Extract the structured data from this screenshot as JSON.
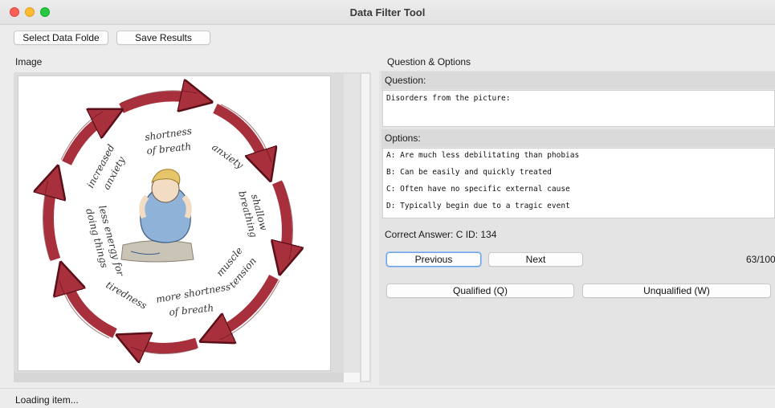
{
  "window": {
    "title": "Data Filter Tool"
  },
  "toolbar": {
    "select_folder_label": "Select Data Folde",
    "save_results_label": "Save Results"
  },
  "image_panel": {
    "label": "Image",
    "diagram": {
      "labels": {
        "shortness_of_breath_1": "shortness",
        "shortness_of_breath_2": "of breath",
        "anxiety": "anxiety",
        "shallow_1": "shallow",
        "shallow_2": "breathing",
        "muscle_1": "muscle",
        "muscle_2": "tension",
        "more_1": "more shortness",
        "more_2": "of breath",
        "tiredness": "tiredness",
        "less_energy_1": "less energy for",
        "less_energy_2": "doing things",
        "increased_1": "increased",
        "increased_2": "anxiety"
      },
      "arrow_color": "#a8303c"
    }
  },
  "right_panel": {
    "label": "Question & Options",
    "question_header": "Question:",
    "question_text": "Disorders from the picture:",
    "options_header": "Options:",
    "options": [
      "A: Are much less debilitating than phobias",
      "B: Can be easily and quickly treated",
      "C: Often have no specific external cause",
      "D: Typically begin due to a tragic event"
    ],
    "correct_answer_text": "Correct Answer:  C    ID:  134",
    "previous_label": "Previous",
    "next_label": "Next",
    "progress_text": "63/100",
    "qualified_label": "Qualified (Q)",
    "unqualified_label": "Unqualified (W)"
  },
  "status_bar": {
    "text": "Loading item..."
  }
}
